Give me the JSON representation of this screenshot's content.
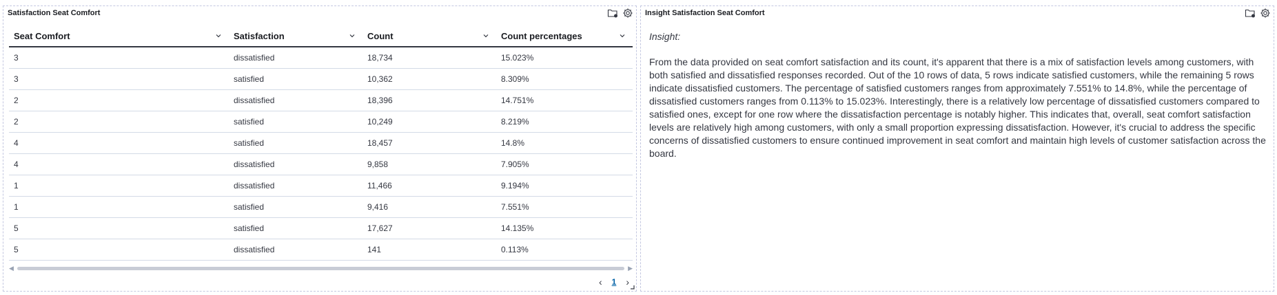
{
  "left_panel": {
    "title": "Satisfaction Seat Comfort",
    "columns": [
      "Seat Comfort",
      "Satisfaction",
      "Count",
      "Count percentages"
    ],
    "rows": [
      [
        "3",
        "dissatisfied",
        "18,734",
        "15.023%"
      ],
      [
        "3",
        "satisfied",
        "10,362",
        "8.309%"
      ],
      [
        "2",
        "dissatisfied",
        "18,396",
        "14.751%"
      ],
      [
        "2",
        "satisfied",
        "10,249",
        "8.219%"
      ],
      [
        "4",
        "satisfied",
        "18,457",
        "14.8%"
      ],
      [
        "4",
        "dissatisfied",
        "9,858",
        "7.905%"
      ],
      [
        "1",
        "dissatisfied",
        "11,466",
        "9.194%"
      ],
      [
        "1",
        "satisfied",
        "9,416",
        "7.551%"
      ],
      [
        "5",
        "satisfied",
        "17,627",
        "14.135%"
      ],
      [
        "5",
        "dissatisfied",
        "141",
        "0.113%"
      ]
    ],
    "pagination": {
      "current_page": "1"
    }
  },
  "right_panel": {
    "title": "Insight Satisfaction Seat Comfort",
    "heading": "Insight:",
    "text": "From the data provided on seat comfort satisfaction and its count, it's apparent that there is a mix of satisfaction levels among customers, with both satisfied and dissatisfied responses recorded. Out of the 10 rows of data, 5 rows indicate satisfied customers, while the remaining 5 rows indicate dissatisfied customers. The percentage of satisfied customers ranges from approximately 7.551% to 14.8%, while the percentage of dissatisfied customers ranges from 0.113% to 15.023%. Interestingly, there is a relatively low percentage of dissatisfied customers compared to satisfied ones, except for one row where the dissatisfaction percentage is notably higher. This indicates that, overall, seat comfort satisfaction levels are relatively high among customers, with only a small proportion expressing dissatisfaction. However, it's crucial to address the specific concerns of dissatisfied customers to ensure continued improvement in seat comfort and maintain high levels of customer satisfaction across the board."
  },
  "icons": [
    "folder-icon",
    "gear-icon",
    "chevron-down-icon",
    "chevron-left-icon",
    "chevron-right-icon",
    "resize-icon"
  ],
  "colors": {
    "accent": "#0061a6",
    "border": "#c3c7e0",
    "row_divider": "#d3dae6"
  }
}
